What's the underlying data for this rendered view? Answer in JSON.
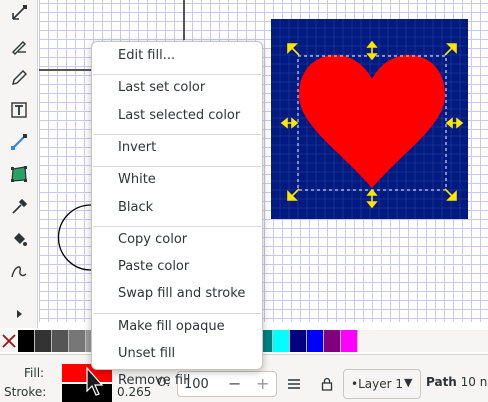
{
  "toolbox": {
    "tools": [
      {
        "name": "node-tool-icon"
      },
      {
        "name": "pen-tool-icon"
      },
      {
        "name": "pencil-tool-icon"
      },
      {
        "name": "text-tool-icon"
      },
      {
        "name": "gradient-tool-icon"
      },
      {
        "name": "mesh-tool-icon"
      },
      {
        "name": "dropper-tool-icon"
      },
      {
        "name": "paint-bucket-icon"
      },
      {
        "name": "spiro-path-icon"
      },
      {
        "name": "more-tools-icon"
      }
    ]
  },
  "canvas": {
    "page_background": "#001a80",
    "heart_color": "#ff0000",
    "handle_color": "#ffe600"
  },
  "context_menu": {
    "groups": [
      [
        "Edit fill..."
      ],
      [
        "Last set color",
        "Last selected color"
      ],
      [
        "Invert"
      ],
      [
        "White",
        "Black"
      ],
      [
        "Copy color",
        "Paste color",
        "Swap fill and stroke"
      ],
      [
        "Make fill opaque",
        "Unset fill",
        "Remove fill"
      ]
    ]
  },
  "palette": {
    "colors": [
      "#000000",
      "#333333",
      "#555555",
      "#777777",
      "#999999",
      "#bbbbbb",
      "#dddddd",
      "#ffffff",
      "#800000",
      "#ff0000",
      "#808000",
      "#ffff00",
      "#008000",
      "#00ff00",
      "#008080",
      "#00ffff",
      "#000080",
      "#0000ff",
      "#800080",
      "#ff00ff"
    ]
  },
  "statusbar": {
    "fill_label": "Fill:",
    "stroke_label": "Stroke:",
    "fill_color": "#ff0000",
    "stroke_color": "#000000",
    "stroke_width": "0.265",
    "opacity_label": "O:",
    "opacity_value": "100",
    "minus": "−",
    "plus": "+",
    "layer_name": "•Layer 1",
    "status_bold": "Path",
    "status_rest": " 10 n"
  }
}
